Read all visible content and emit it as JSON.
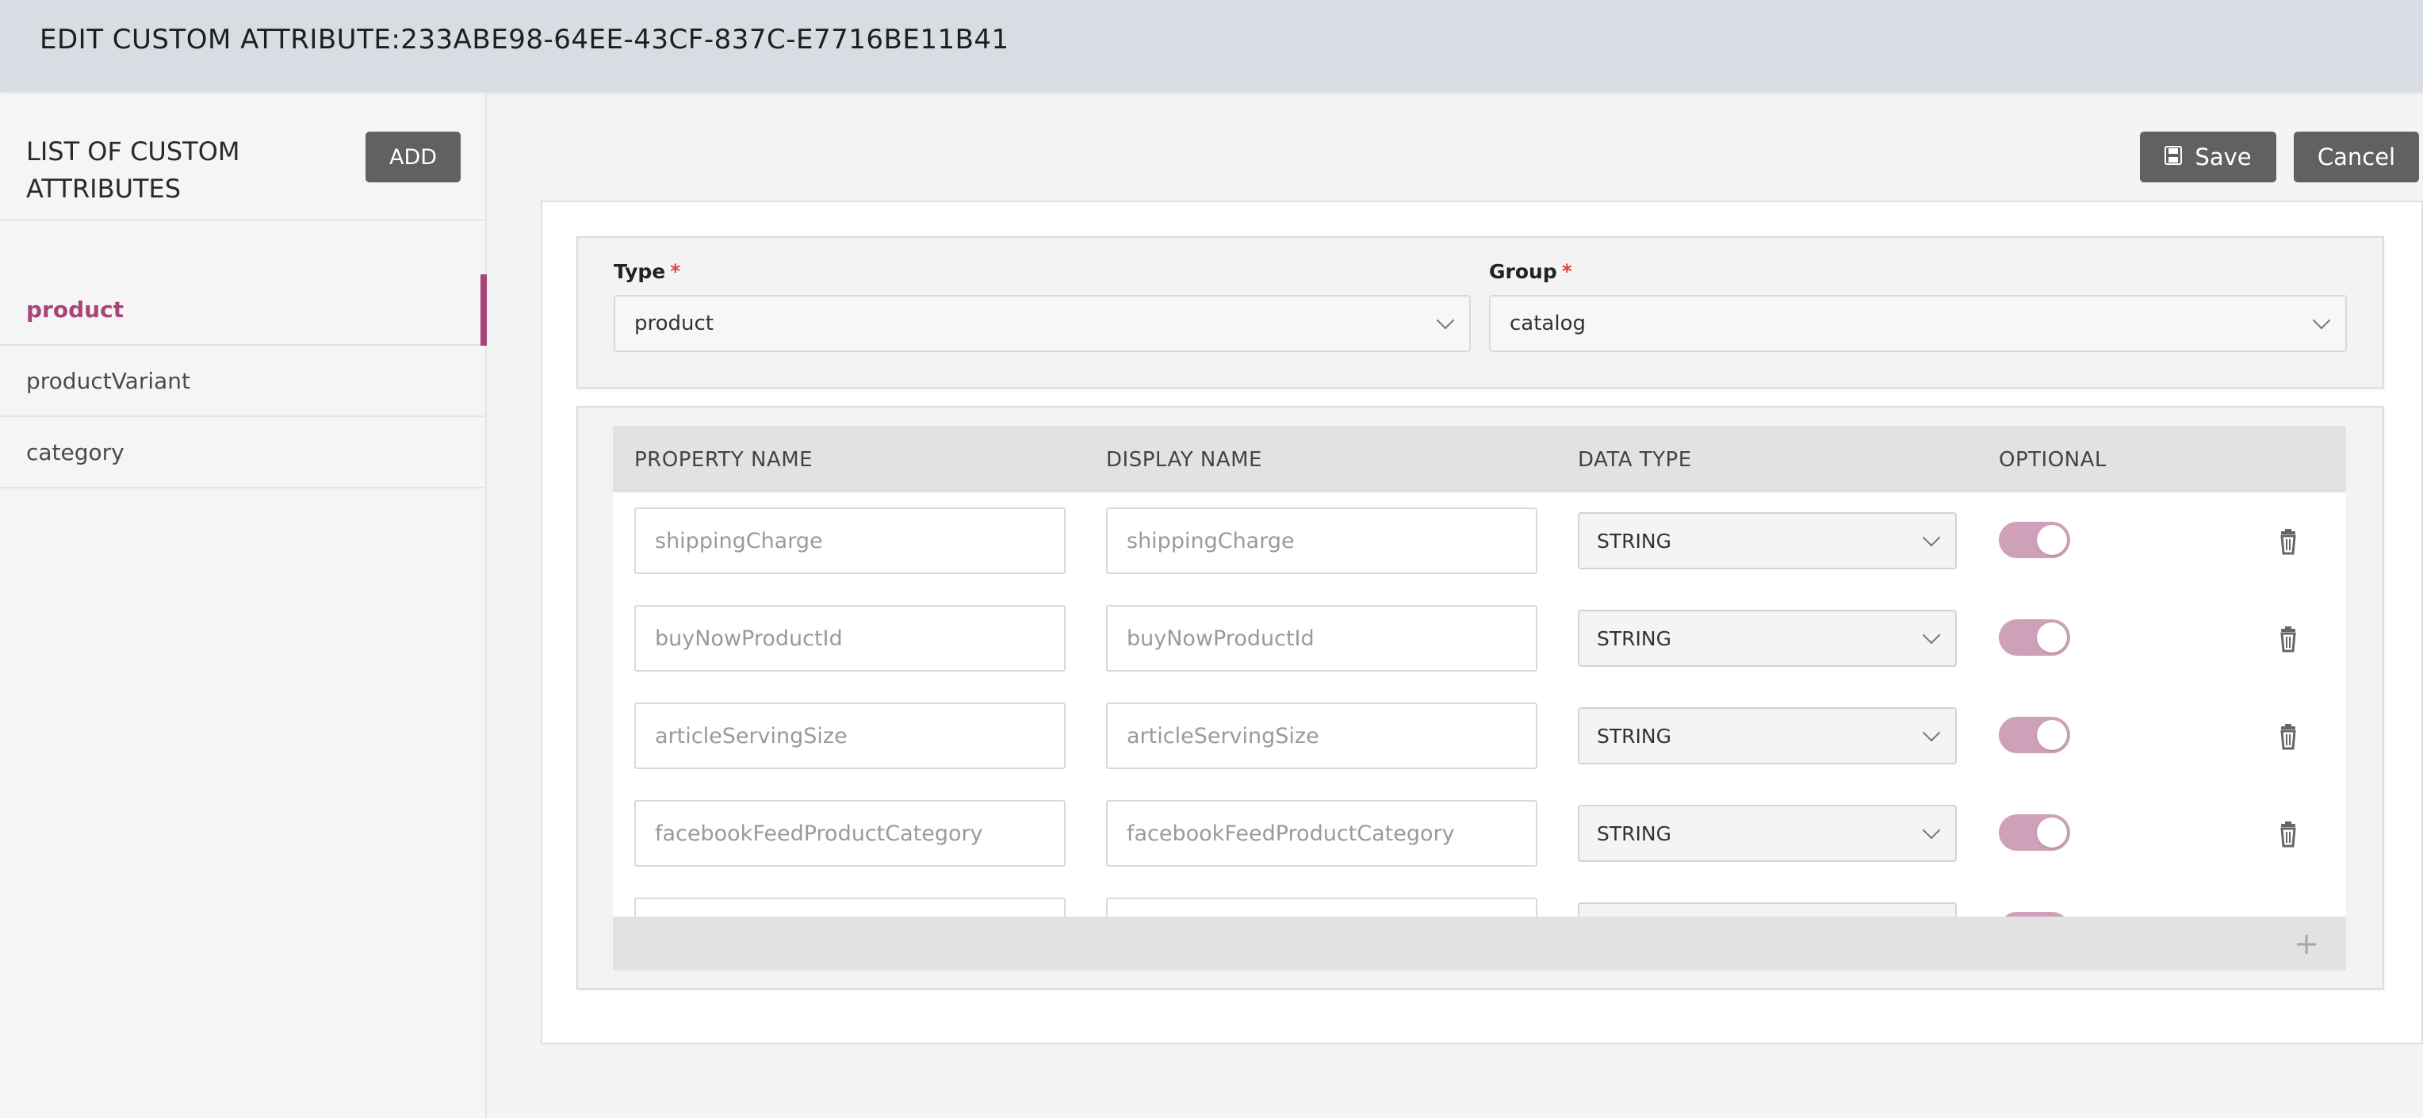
{
  "header": {
    "title": "EDIT CUSTOM ATTRIBUTE:233ABE98-64EE-43CF-837C-E7716BE11B41"
  },
  "sidebar": {
    "heading": "LIST OF CUSTOM ATTRIBUTES",
    "add_label": "ADD",
    "items": [
      {
        "label": "product",
        "active": true
      },
      {
        "label": "productVariant",
        "active": false
      },
      {
        "label": "category",
        "active": false
      }
    ]
  },
  "toolbar": {
    "save_label": "Save",
    "cancel_label": "Cancel",
    "save_icon": "floppy-disk-icon"
  },
  "form": {
    "type": {
      "label": "Type",
      "required_mark": "*",
      "value": "product"
    },
    "group": {
      "label": "Group",
      "required_mark": "*",
      "value": "catalog"
    }
  },
  "table": {
    "columns": [
      "PROPERTY NAME",
      "DISPLAY NAME",
      "DATA TYPE",
      "OPTIONAL"
    ],
    "rows": [
      {
        "property_name": "shippingCharge",
        "display_name": "shippingCharge",
        "data_type": "STRING",
        "optional": true
      },
      {
        "property_name": "buyNowProductId",
        "display_name": "buyNowProductId",
        "data_type": "STRING",
        "optional": true
      },
      {
        "property_name": "articleServingSize",
        "display_name": "articleServingSize",
        "data_type": "STRING",
        "optional": true
      },
      {
        "property_name": "facebookFeedProductCategory",
        "display_name": "facebookFeedProductCategory",
        "data_type": "STRING",
        "optional": true
      }
    ],
    "add_row_icon": "plus-icon"
  },
  "colors": {
    "accent": "#a84477",
    "toggle_on": "#cfa1b9",
    "button": "#616161",
    "header_bg": "#d8dce3"
  }
}
